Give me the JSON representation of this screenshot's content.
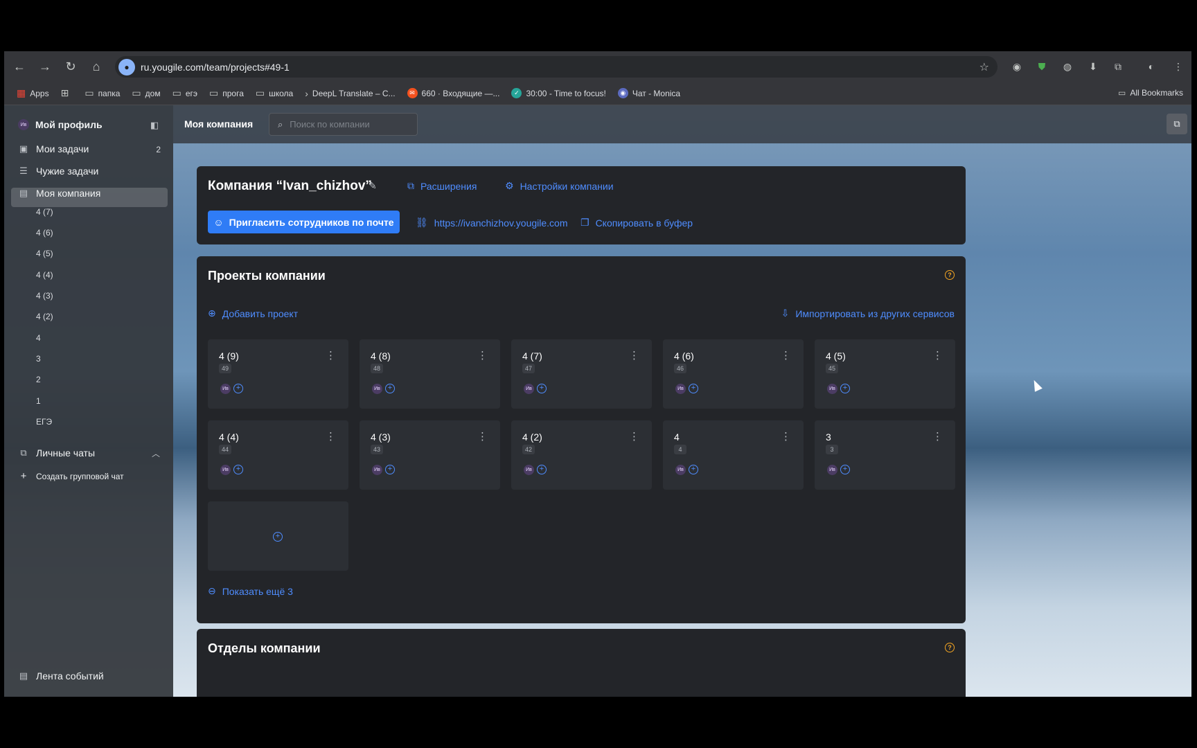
{
  "browser": {
    "url": "ru.yougile.com/team/projects#49-1",
    "bookmarks": [
      {
        "label": "Apps",
        "icon": "apps-grid-icon"
      },
      {
        "label": "",
        "icon": "tab-groups-icon"
      },
      {
        "label": "папка",
        "icon": "folder-icon"
      },
      {
        "label": "дом",
        "icon": "folder-icon"
      },
      {
        "label": "егэ",
        "icon": "folder-icon"
      },
      {
        "label": "прога",
        "icon": "folder-icon"
      },
      {
        "label": "школа",
        "icon": "folder-icon"
      },
      {
        "label": "DeepL Translate – С...",
        "icon": "deepl-icon"
      },
      {
        "label": "660 · Входящие —...",
        "icon": "mail-icon"
      },
      {
        "label": "30:00 - Time to focus!",
        "icon": "check-circle-icon"
      },
      {
        "label": "Чат - Monica",
        "icon": "monica-icon"
      }
    ],
    "all_bookmarks": "All Bookmarks"
  },
  "sidebar": {
    "profile": "Мой профиль",
    "profile_avatar": "Ив",
    "items": [
      {
        "label": "Мои задачи",
        "count": "2"
      },
      {
        "label": "Чужие задачи",
        "count": ""
      },
      {
        "label": "Моя компания",
        "count": ""
      }
    ],
    "projects": [
      "4 (7)",
      "4 (6)",
      "4 (5)",
      "4 (4)",
      "4 (3)",
      "4 (2)",
      "4",
      "3",
      "2",
      "1",
      "ЕГЭ"
    ],
    "chats": "Личные чаты",
    "create_group_chat": "Создать групповой чат",
    "events_feed": "Лента событий"
  },
  "topbar": {
    "title": "Моя компания",
    "search_placeholder": "Поиск по компании"
  },
  "company": {
    "name": "Компания “Ivan_chizhov”",
    "extensions": "Расширения",
    "settings": "Настройки компании",
    "invite_button": "Пригласить сотрудников по почте",
    "link": "https://ivanchizhov.yougile.com",
    "copy": "Скопировать в буфер"
  },
  "projects": {
    "title": "Проекты компании",
    "add": "Добавить проект",
    "import": "Импортировать из других сервисов",
    "show_more": "Показать ещё 3",
    "cards": [
      {
        "name": "4 (9)",
        "num": "49",
        "member": "Ив"
      },
      {
        "name": "4 (8)",
        "num": "48",
        "member": "Ив"
      },
      {
        "name": "4 (7)",
        "num": "47",
        "member": "Ив"
      },
      {
        "name": "4 (6)",
        "num": "46",
        "member": "Ив"
      },
      {
        "name": "4 (5)",
        "num": "45",
        "member": "Ив"
      },
      {
        "name": "4 (4)",
        "num": "44",
        "member": "Ив"
      },
      {
        "name": "4 (3)",
        "num": "43",
        "member": "Ив"
      },
      {
        "name": "4 (2)",
        "num": "42",
        "member": "Ив"
      },
      {
        "name": "4",
        "num": "4",
        "member": "Ив"
      },
      {
        "name": "3",
        "num": "3",
        "member": "Ив"
      }
    ]
  },
  "departments": {
    "title": "Отделы компании"
  },
  "colors": {
    "accent": "#2f7cf6",
    "link": "#4f8dff",
    "help": "#f5a623"
  }
}
